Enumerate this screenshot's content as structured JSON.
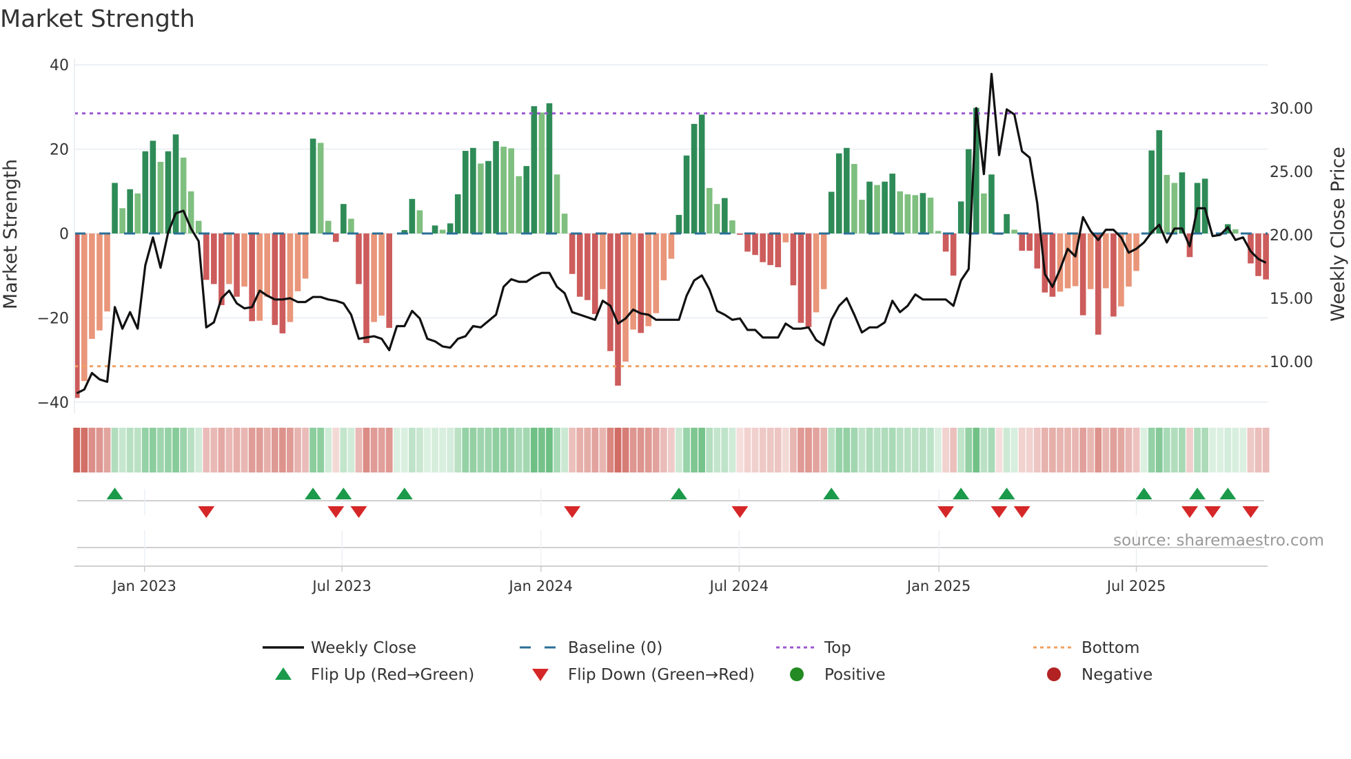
{
  "chart_data": {
    "type": "bar",
    "title": "Market Strength",
    "ylabel": "Market Strength",
    "y2label": "Weekly Close Price",
    "source": "source: sharemaestro.com",
    "ylim": [
      -42,
      42
    ],
    "y2lim": [
      6.8,
      33.5
    ],
    "yticks": [
      40,
      20,
      0,
      -20,
      -40
    ],
    "yticklabels": [
      "40",
      "20",
      "0",
      "−20",
      "−40"
    ],
    "y2ticks": [
      30,
      25,
      20,
      15,
      10
    ],
    "y2ticklabels": [
      "30.00",
      "25.00",
      "20.00",
      "15.00",
      "10.00"
    ],
    "x_unit": "week index",
    "xticks": [
      {
        "x": 8.9,
        "label": "Jan 2023"
      },
      {
        "x": 34.8,
        "label": "Jul 2023"
      },
      {
        "x": 60.9,
        "label": "Jan 2024"
      },
      {
        "x": 86.9,
        "label": "Jul 2024"
      },
      {
        "x": 113.1,
        "label": "Jan 2025"
      },
      {
        "x": 139.0,
        "label": "Jul 2025"
      }
    ],
    "top_level": 28.5,
    "bottom_level": -31.5,
    "baseline": 0,
    "strength": [
      -39,
      -35,
      -25,
      -23,
      -18.5,
      12,
      6,
      10.5,
      9.5,
      19.5,
      22,
      17,
      19.5,
      23.5,
      18,
      10,
      3,
      -11,
      -12,
      -17,
      -12,
      -15,
      -12.6,
      -20.8,
      -20.7,
      -15,
      -21.7,
      -23.7,
      -21,
      -13.7,
      -10.7,
      22.5,
      21.5,
      3,
      -2,
      7,
      3.5,
      -12,
      -26,
      -21,
      -19.5,
      -22.4,
      0,
      0.8,
      8.2,
      5.5,
      0,
      1.9,
      0.9,
      2.4,
      9.3,
      19.6,
      20.3,
      16.6,
      17.2,
      21.9,
      20.6,
      20.2,
      13.6,
      16,
      30.2,
      28.7,
      30.9,
      14,
      4.7,
      -9.6,
      -15,
      -15.8,
      -19.1,
      -13.2,
      -27.9,
      -36.1,
      -30.4,
      -22.8,
      -23.6,
      -22,
      -18.9,
      -11.1,
      -6,
      4.4,
      18.5,
      26,
      28.2,
      10.8,
      7,
      8.4,
      3.1,
      -0.3,
      -4.3,
      -5.1,
      -6.8,
      -7.5,
      -8,
      -2.1,
      -12.3,
      -21.2,
      -22.2,
      -18.7,
      -13.2,
      9.9,
      19,
      20.3,
      16.5,
      8,
      12.3,
      11.5,
      12.3,
      14.2,
      10,
      9.3,
      9.1,
      9.6,
      8.5,
      0.6,
      -4.3,
      -10,
      7.6,
      20,
      29.8,
      9.5,
      14,
      -0.3,
      4.6,
      0.9,
      -4.1,
      -4.1,
      -8.3,
      -14,
      -15,
      -13.8,
      -13,
      -12.5,
      -19.4,
      -13.2,
      -24,
      -13,
      -19.7,
      -17.3,
      -12.6,
      -8.9,
      0,
      19.7,
      24.5,
      13.9,
      12,
      14.5,
      -5.6,
      12,
      13,
      0,
      0,
      2.2,
      1,
      0,
      -7.1,
      -10.1,
      -10.9
    ],
    "weekly_close": [
      7.5,
      7.8,
      9.1,
      8.6,
      8.4,
      14.3,
      12.6,
      13.9,
      12.6,
      17.6,
      19.8,
      17.4,
      20.2,
      21.7,
      21.9,
      20.5,
      19.5,
      12.7,
      13.1,
      15.0,
      15.6,
      14.6,
      14.2,
      14.3,
      15.6,
      15.2,
      14.9,
      14.9,
      15.0,
      14.7,
      14.7,
      15.1,
      15.1,
      14.9,
      14.8,
      14.6,
      13.7,
      11.8,
      11.9,
      12.0,
      11.8,
      10.9,
      12.8,
      12.8,
      14.0,
      13.4,
      11.8,
      11.6,
      11.2,
      11.1,
      11.8,
      12.0,
      12.8,
      12.7,
      13.2,
      13.7,
      15.9,
      16.5,
      16.3,
      16.3,
      16.7,
      17.0,
      17.0,
      15.9,
      15.4,
      13.9,
      13.7,
      13.5,
      13.3,
      14.8,
      14.4,
      13.0,
      13.4,
      14.1,
      13.8,
      13.7,
      13.3,
      13.3,
      13.3,
      13.3,
      15.2,
      16.4,
      16.8,
      15.7,
      14.0,
      13.7,
      13.3,
      13.4,
      12.5,
      12.5,
      11.9,
      11.9,
      11.9,
      13.0,
      12.6,
      12.6,
      12.7,
      11.7,
      11.3,
      13.3,
      14.4,
      15.0,
      13.7,
      12.3,
      12.7,
      12.7,
      13.1,
      14.8,
      13.9,
      14.4,
      15.3,
      14.9,
      14.9,
      14.9,
      14.9,
      14.4,
      16.4,
      17.3,
      30.0,
      24.8,
      32.7,
      26.3,
      29.9,
      29.5,
      26.6,
      26.1,
      22.5,
      16.9,
      15.9,
      17.3,
      18.9,
      18.3,
      21.4,
      20.3,
      19.6,
      20.4,
      20.4,
      19.8,
      18.6,
      18.9,
      19.4,
      20.2,
      20.8,
      19.4,
      20.5,
      20.5,
      19.1,
      22.1,
      22.1,
      19.9,
      20.0,
      20.6,
      19.6,
      19.8,
      18.7,
      18.1,
      17.8
    ],
    "flip_up_weeks": [
      5,
      31,
      35,
      43,
      79,
      99,
      116,
      122,
      140,
      147,
      151
    ],
    "flip_down_weeks": [
      17,
      34,
      37,
      65,
      87,
      114,
      121,
      124,
      146,
      149,
      154
    ],
    "colors": {
      "pos_strong": "#2e8b57",
      "pos_weak": "#7fbf7f",
      "neg_strong": "#cd5c5c",
      "neg_weak": "#e9967a",
      "line": "#111111",
      "baseline": "#2a6f97",
      "top": "#9b59d0",
      "bottom": "#f0a060",
      "flip_up": "#1a9a4a",
      "flip_down": "#d62728",
      "positive": "#228b22",
      "negative": "#b22222"
    },
    "legend": {
      "placement": "bottom",
      "items": [
        {
          "label": "Weekly Close",
          "symbol": "line"
        },
        {
          "label": "Baseline (0)",
          "symbol": "dash"
        },
        {
          "label": "Top",
          "symbol": "dot-purple"
        },
        {
          "label": "Bottom",
          "symbol": "dot-orange"
        },
        {
          "label": "Flip Up (Red→Green)",
          "symbol": "tri-up"
        },
        {
          "label": "Flip Down (Green→Red)",
          "symbol": "tri-down"
        },
        {
          "label": "Positive",
          "symbol": "circle-green"
        },
        {
          "label": "Negative",
          "symbol": "circle-red"
        }
      ]
    }
  }
}
